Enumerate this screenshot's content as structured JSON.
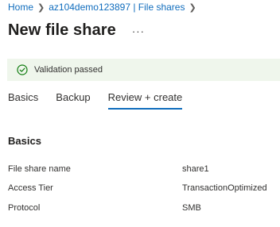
{
  "breadcrumb": {
    "items": [
      "Home",
      "az104demo123897 | File shares"
    ]
  },
  "header": {
    "title": "New file share",
    "more_label": "···"
  },
  "validation": {
    "message": "Validation passed",
    "color": "#107c10",
    "background": "#eff6ec"
  },
  "tabs": [
    {
      "label": "Basics",
      "active": false
    },
    {
      "label": "Backup",
      "active": false
    },
    {
      "label": "Review + create",
      "active": true
    }
  ],
  "section": {
    "title": "Basics",
    "rows": [
      {
        "label": "File share name",
        "value": "share1"
      },
      {
        "label": "Access Tier",
        "value": "TransactionOptimized"
      },
      {
        "label": "Protocol",
        "value": "SMB"
      }
    ]
  },
  "colors": {
    "accent": "#0f6cbd",
    "text": "#323130"
  }
}
